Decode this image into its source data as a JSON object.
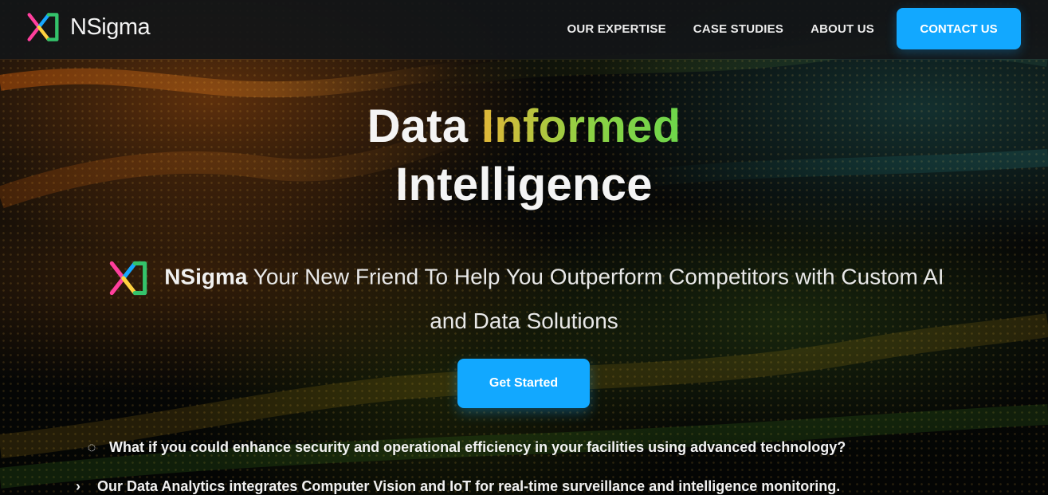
{
  "brand": {
    "name": "NSigma"
  },
  "nav": {
    "items": [
      {
        "label": "OUR EXPERTISE"
      },
      {
        "label": "CASE STUDIES"
      },
      {
        "label": "ABOUT US"
      }
    ],
    "contact_label": "CONTACT US"
  },
  "hero": {
    "title_prefix": "Data",
    "title_highlight": "Informed",
    "title_line_2": "Intelligence",
    "tagline_brand": "NSigma",
    "tagline_rest_1": "Your New Friend To Help You Outperform Competitors with Custom AI",
    "tagline_line_2": "and Data Solutions",
    "cta_label": "Get Started",
    "question_text": "What if you could enhance security and operational efficiency in your facilities using advanced technology?",
    "partial_text": "Our Data Analytics integrates Computer Vision and IoT for real-time surveillance and intelligence monitoring."
  },
  "icons": {
    "logo": "nsigma-logo-icon",
    "question": "question-icon",
    "arrow": "arrow-right-icon"
  },
  "colors": {
    "accent": "#12a8ff",
    "highlight_start": "#e1b638",
    "highlight_end": "#6dd64b"
  }
}
